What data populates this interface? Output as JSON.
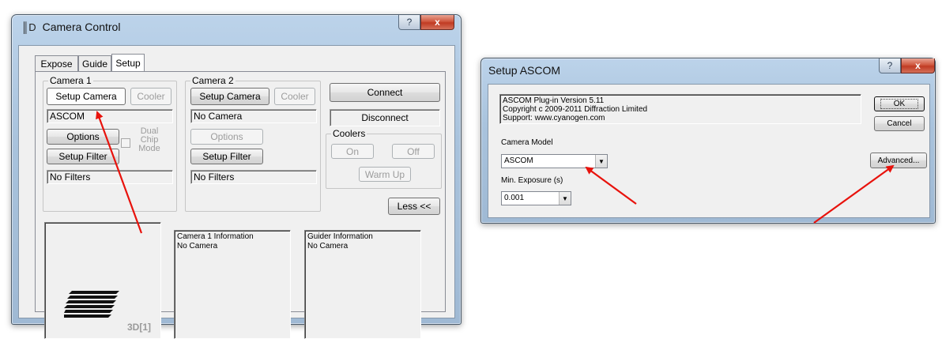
{
  "camera_control": {
    "title": "Camera Control",
    "app_icon": "3d-logo-icon",
    "help_button": "?",
    "close_button": "x",
    "tabs": [
      {
        "label": "Expose"
      },
      {
        "label": "Guide"
      },
      {
        "label": "Setup",
        "active": true
      }
    ],
    "camera1": {
      "group_label": "Camera 1",
      "setup_button": "Setup Camera",
      "cooler_button": "Cooler",
      "camera_value": "ASCOM",
      "options_button": "Options",
      "dual_chip_label": "Dual\nChip\nMode",
      "setup_filter_button": "Setup Filter",
      "filter_value": "No Filters"
    },
    "camera2": {
      "group_label": "Camera 2",
      "setup_button": "Setup Camera",
      "cooler_button": "Cooler",
      "camera_value": "No Camera",
      "options_button": "Options",
      "setup_filter_button": "Setup Filter",
      "filter_value": "No Filters"
    },
    "connect_button": "Connect",
    "disconnect_button": "Disconnect",
    "coolers": {
      "group_label": "Coolers",
      "on_button": "On",
      "off_button": "Off",
      "warmup_button": "Warm Up"
    },
    "less_button": "Less <<",
    "logo_text": "3D[1]",
    "camera1_info": {
      "heading": "Camera 1 Information",
      "value": "No Camera"
    },
    "guider_info": {
      "heading": "Guider Information",
      "value": "No Camera"
    }
  },
  "setup_ascom": {
    "title": "Setup ASCOM",
    "help_button": "?",
    "close_button": "x",
    "info_lines": [
      "ASCOM Plug-in Version 5.11",
      "Copyright c 2009-2011 Diffraction Limited",
      "Support: www.cyanogen.com"
    ],
    "ok_button": "OK",
    "cancel_button": "Cancel",
    "camera_model_label": "Camera Model",
    "camera_model_value": "ASCOM",
    "advanced_button": "Advanced...",
    "min_exposure_label": "Min. Exposure (s)",
    "min_exposure_value": "0.001"
  },
  "colors": {
    "annotation_arrow": "#e8120c",
    "title_bar": "#a9c3dd",
    "close_button": "#c13b23"
  }
}
